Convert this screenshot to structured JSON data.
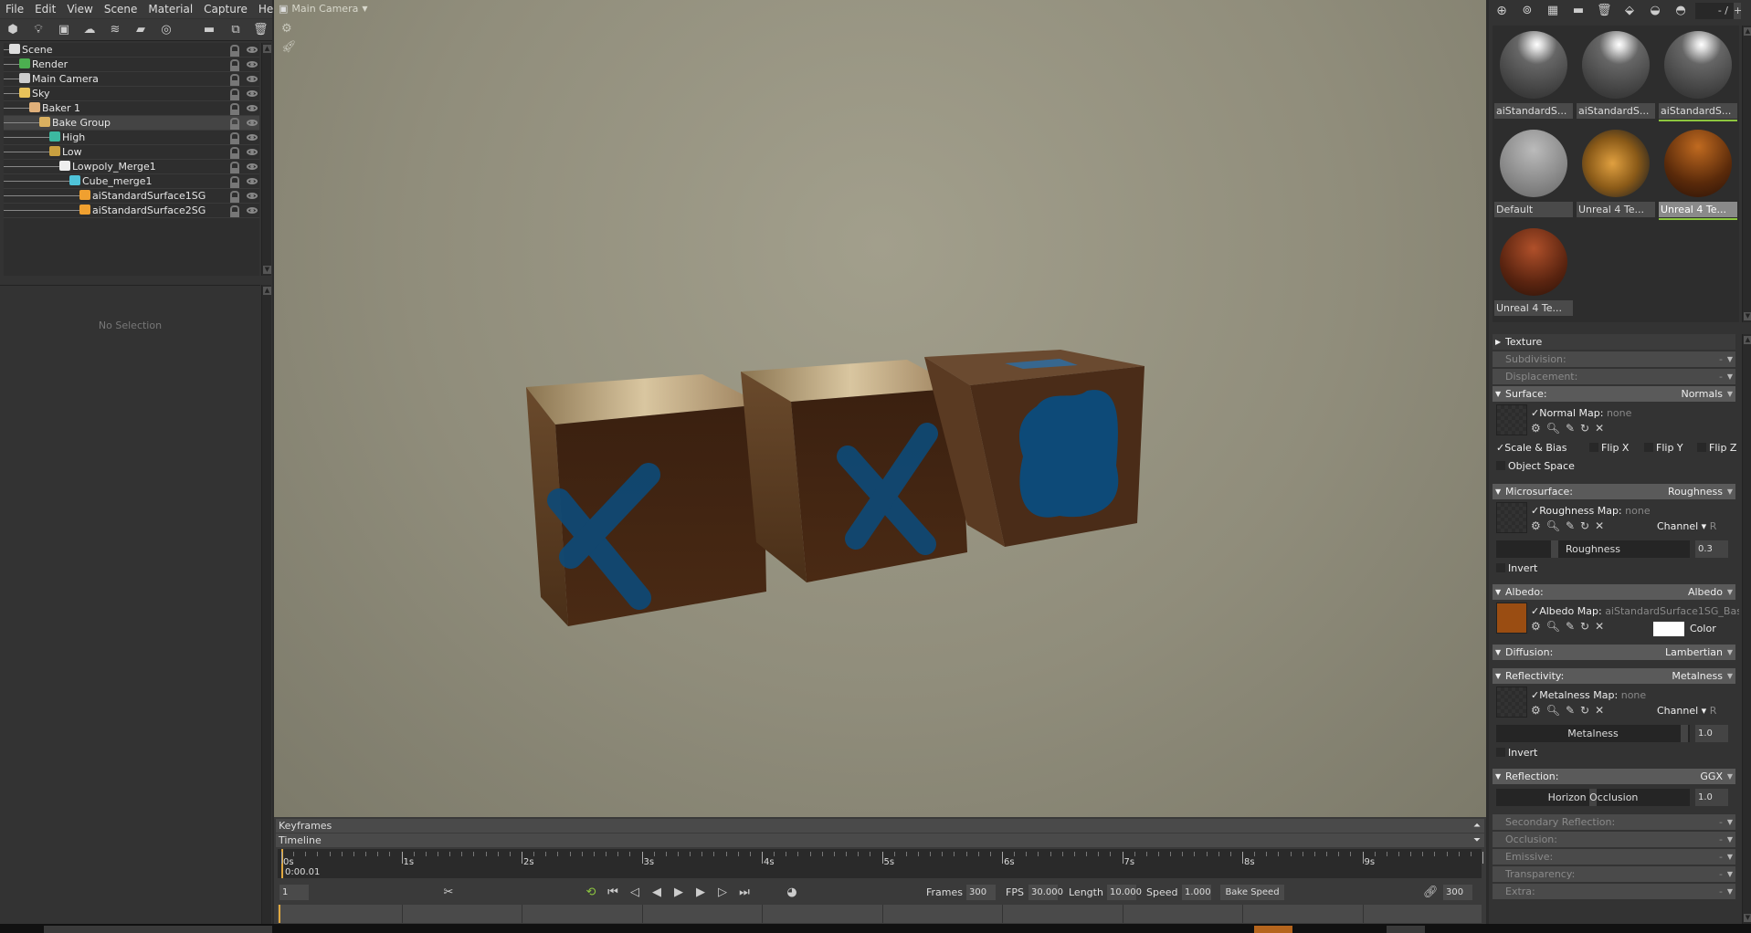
{
  "menu": [
    "File",
    "Edit",
    "View",
    "Scene",
    "Material",
    "Capture",
    "Help"
  ],
  "scene_toolbar": [
    "cube-icon",
    "light-icon",
    "camera-icon",
    "sky-icon",
    "fog-icon",
    "baker-icon",
    "turntable-icon",
    "folder-icon",
    "duplicate-icon",
    "trash-icon"
  ],
  "tree": [
    {
      "label": "Scene",
      "depth": 0,
      "icon": "scene-icon",
      "color": "#ddd"
    },
    {
      "label": "Render",
      "depth": 1,
      "icon": "gear-icon",
      "color": "#4caf50"
    },
    {
      "label": "Main Camera",
      "depth": 1,
      "icon": "camera-icon",
      "color": "#ccc"
    },
    {
      "label": "Sky",
      "depth": 1,
      "icon": "sky-icon",
      "color": "#e8c25a"
    },
    {
      "label": "Baker 1",
      "depth": 2,
      "icon": "baker-icon",
      "color": "#e0b07a"
    },
    {
      "label": "Bake Group",
      "depth": 3,
      "icon": "folder-icon",
      "color": "#d9b060",
      "selected": true
    },
    {
      "label": "High",
      "depth": 4,
      "icon": "high-mesh-icon",
      "color": "#3cb8a0"
    },
    {
      "label": "Low",
      "depth": 4,
      "icon": "low-mesh-icon",
      "color": "#c9a040"
    },
    {
      "label": "Lowpoly_Merge1",
      "depth": 5,
      "icon": "mesh-file-icon",
      "color": "#eee"
    },
    {
      "label": "Cube_merge1",
      "depth": 6,
      "icon": "mesh-icon",
      "color": "#4fc3d9"
    },
    {
      "label": "aiStandardSurface1SG",
      "depth": 7,
      "icon": "material-icon",
      "color": "#f0a030"
    },
    {
      "label": "aiStandardSurface2SG",
      "depth": 7,
      "icon": "material-icon",
      "color": "#f0a030"
    }
  ],
  "properties": {
    "empty_text": "No Selection"
  },
  "viewport": {
    "camera_label": "Main Camera"
  },
  "timeline": {
    "keyframes_label": "Keyframes",
    "timeline_label": "Timeline",
    "ticks": [
      "0s",
      "1s",
      "2s",
      "3s",
      "4s",
      "5s",
      "6s",
      "7s",
      "8s",
      "9s"
    ],
    "current_time": "0:00.01",
    "current_frame": "1",
    "frames_label": "Frames",
    "frames": "300",
    "fps_label": "FPS",
    "fps": "30.000",
    "length_label": "Length",
    "length": "10.000",
    "speed_label": "Speed",
    "speed": "1.000",
    "bake_speed": "Bake Speed",
    "end_frame": "300",
    "loop_color": "#8dc63f"
  },
  "material_toolbar": {
    "icons": [
      "add-icon",
      "duplicate-icon",
      "checker-icon",
      "folder-icon",
      "trash-icon",
      "pick-icon",
      "import-icon",
      "export-icon"
    ],
    "page": "- /",
    "page_plus": "+"
  },
  "materials": [
    {
      "name": "aiStandardS...",
      "style": "grey"
    },
    {
      "name": "aiStandardS...",
      "style": "grey"
    },
    {
      "name": "aiStandardS...",
      "style": "grey",
      "underline": true
    },
    {
      "name": "Default",
      "style": "plain"
    },
    {
      "name": "Unreal 4 Te...",
      "style": "gold"
    },
    {
      "name": "Unreal 4 Te...",
      "style": "copper",
      "selected": true
    },
    {
      "name": "Unreal 4 Te...",
      "style": "copper2"
    }
  ],
  "mat_props": {
    "texture": "Texture",
    "subdivision": "Subdivision:",
    "displacement": "Displacement:",
    "dash": "-",
    "surface": "Surface:",
    "surface_val": "Normals",
    "normal_map": "Normal Map:",
    "none": "none",
    "scale_bias": "Scale & Bias",
    "flip_x": "Flip X",
    "flip_y": "Flip Y",
    "flip_z": "Flip Z",
    "object_space": "Object Space",
    "microsurface": "Microsurface:",
    "microsurface_val": "Roughness",
    "roughness_map": "Roughness Map:",
    "channel": "Channel",
    "channel_val": "R",
    "roughness": "Roughness",
    "roughness_val": "0.3",
    "invert": "Invert",
    "albedo": "Albedo:",
    "albedo_val": "Albedo",
    "albedo_map": "Albedo Map:",
    "albedo_map_val": "aiStandardSurface1SG_Bas",
    "color": "Color",
    "diffusion": "Diffusion:",
    "diffusion_val": "Lambertian",
    "reflectivity": "Reflectivity:",
    "reflectivity_val": "Metalness",
    "metalness_map": "Metalness Map:",
    "metalness": "Metalness",
    "metalness_val": "1.0",
    "reflection": "Reflection:",
    "reflection_val": "GGX",
    "horizon": "Horizon Occlusion",
    "horizon_val": "1.0",
    "secondary": "Secondary Reflection:",
    "occlusion": "Occlusion:",
    "emissive": "Emissive:",
    "transparency": "Transparency:",
    "extra": "Extra:"
  }
}
